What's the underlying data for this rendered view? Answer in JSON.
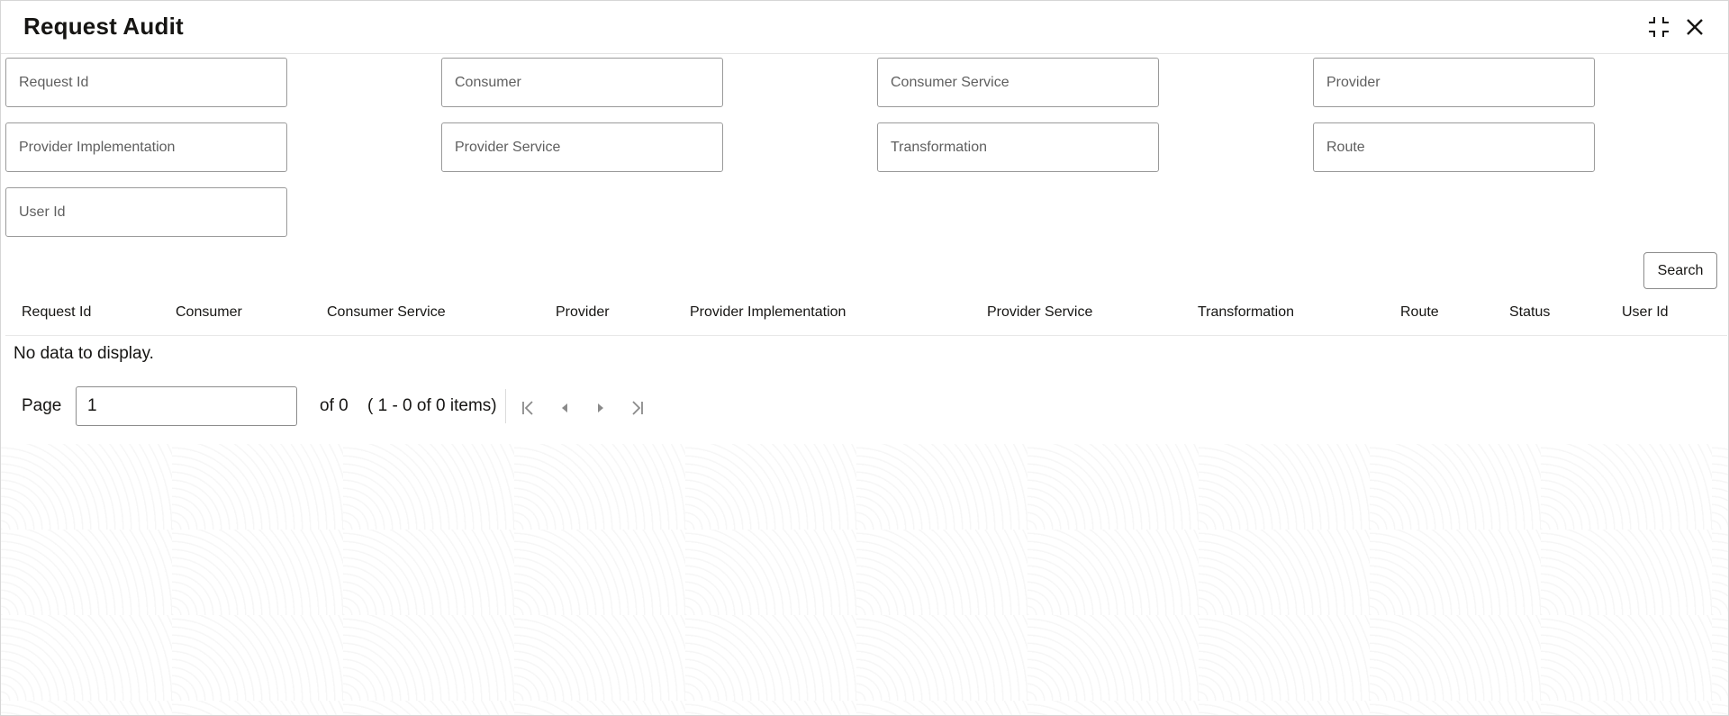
{
  "header": {
    "title": "Request Audit",
    "compress_icon": "compress-icon",
    "close_icon": "close-icon"
  },
  "form": {
    "fields": [
      {
        "placeholder": "Request Id",
        "value": ""
      },
      {
        "placeholder": "Consumer",
        "value": ""
      },
      {
        "placeholder": "Consumer Service",
        "value": ""
      },
      {
        "placeholder": "Provider",
        "value": ""
      },
      {
        "placeholder": "Provider Implementation",
        "value": ""
      },
      {
        "placeholder": "Provider Service",
        "value": ""
      },
      {
        "placeholder": "Transformation",
        "value": ""
      },
      {
        "placeholder": "Route",
        "value": ""
      },
      {
        "placeholder": "User Id",
        "value": ""
      }
    ],
    "search_label": "Search"
  },
  "table": {
    "columns": [
      "Request Id",
      "Consumer",
      "Consumer Service",
      "Provider",
      "Provider Implementation",
      "Provider Service",
      "Transformation",
      "Route",
      "Status",
      "User Id"
    ],
    "rows": [],
    "empty_message": "No data to display."
  },
  "pagination": {
    "page_label": "Page",
    "page_value": "1",
    "of_text": "of 0",
    "range_text": "( 1 - 0 of 0 items)",
    "icons": [
      "first-page-icon",
      "previous-page-icon",
      "next-page-icon",
      "last-page-icon"
    ]
  },
  "colors": {
    "text": "#161513",
    "border": "#9a9a9a",
    "background": "#ffffff"
  }
}
